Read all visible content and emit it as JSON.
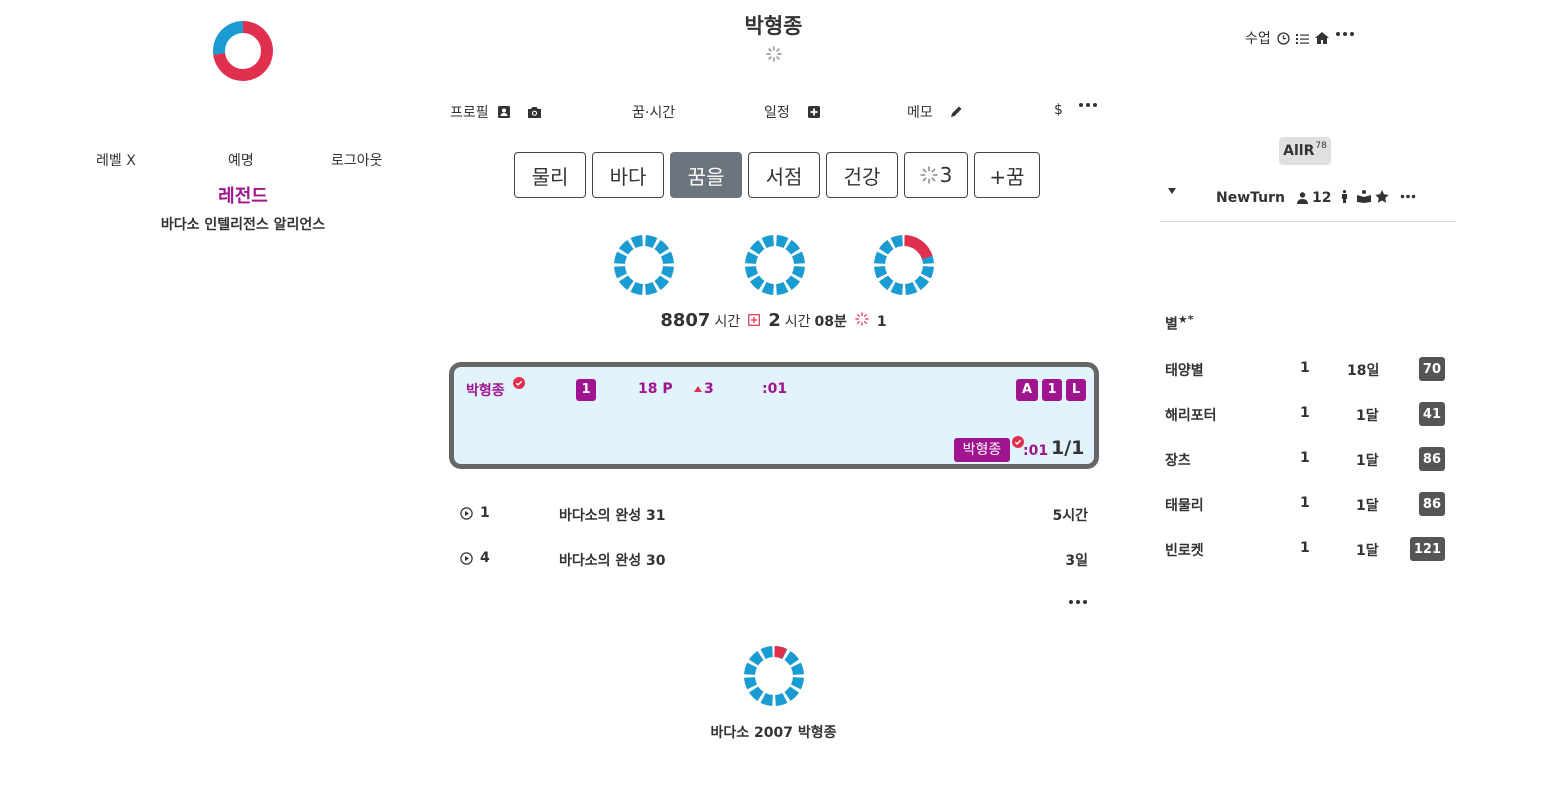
{
  "header": {
    "title": "박형종"
  },
  "nav": {
    "profile_label": "프로필",
    "dream_time_label": "꿈·시간",
    "schedule_label": "일정",
    "memo_label": "메모",
    "currency_label": "$"
  },
  "left": {
    "links": [
      "레벨 X",
      "예명",
      "로그아웃"
    ],
    "rank": "레전드",
    "alliance": "바다소 인텔리전스 알리언스"
  },
  "tabs": [
    {
      "label": "물리",
      "active": false
    },
    {
      "label": "바다",
      "active": false
    },
    {
      "label": "꿈을",
      "active": true
    },
    {
      "label": "서점",
      "active": false
    },
    {
      "label": "건강",
      "active": false
    },
    {
      "label": "3",
      "active": false,
      "icon": "spinner-icon"
    },
    {
      "label": "+꿈",
      "active": false
    }
  ],
  "stats": {
    "total_hours": "8807",
    "hours_unit": "시간",
    "today_hours": "2",
    "today_hours_unit": "시간",
    "today_minutes": "08분",
    "count": "1"
  },
  "card": {
    "name": "박형종",
    "badge_level": "1",
    "points": "18 P",
    "rise": "3",
    "time": ":01",
    "badges_right": [
      "A",
      "1",
      "L"
    ],
    "bottom_name": "박형종",
    "bottom_time": ":01",
    "fraction": "1/1"
  },
  "list": [
    {
      "num": "1",
      "title": "바다소의 완성 31",
      "duration": "5시간"
    },
    {
      "num": "4",
      "title": "바다소의 완성 30",
      "duration": "3일"
    }
  ],
  "right": {
    "class_label": "수업",
    "allr_label": "AllR",
    "allr_sup": "78",
    "team_name": "NewTurn",
    "member_count": "12",
    "star_heading": "별",
    "star_heading_sup": "★*",
    "stars": [
      {
        "name": "태양별",
        "count": "1",
        "period": "18일",
        "score": "70"
      },
      {
        "name": "해리포터",
        "count": "1",
        "period": "1달",
        "score": "41"
      },
      {
        "name": "장츠",
        "count": "1",
        "period": "1달",
        "score": "86"
      },
      {
        "name": "태물리",
        "count": "1",
        "period": "1달",
        "score": "86"
      },
      {
        "name": "빈로켓",
        "count": "1",
        "period": "1달",
        "score": "121"
      }
    ]
  },
  "footer": {
    "text": "바다소 2007 박형종"
  },
  "colors": {
    "accent": "#a0158f",
    "ring_blue": "#1a9bd1",
    "ring_red": "#e0304d",
    "card_bg": "#e1f3fd",
    "tab_active": "#6c757d",
    "score_badge": "#555555"
  },
  "rings": [
    {
      "name": "profile-progress-ring",
      "red_fraction": 0.73
    },
    {
      "name": "dream-ring-1",
      "red_fraction": 0
    },
    {
      "name": "dream-ring-2",
      "red_fraction": 0
    },
    {
      "name": "dream-ring-3",
      "red_fraction": 0.2
    },
    {
      "name": "footer-ring",
      "red_fraction": 0.07
    }
  ]
}
